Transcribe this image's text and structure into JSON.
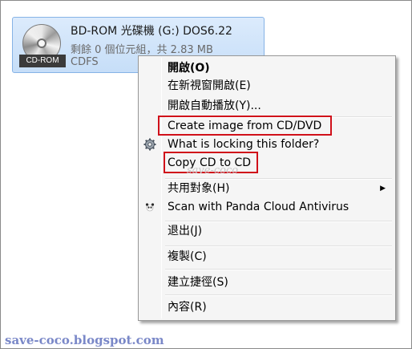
{
  "drive": {
    "title": "BD-ROM 光碟機 (G:) DOS6.22",
    "free_space": "剩餘 0 個位元組，共 2.83 MB",
    "filesystem": "CDFS",
    "icon_label": "CD-ROM",
    "icon": "cd-rom-drive-icon"
  },
  "menu": {
    "items": [
      {
        "label": "開啟(O)"
      },
      {
        "label": "在新視窗開啟(E)"
      },
      {
        "label": "開啟自動播放(Y)..."
      },
      {
        "label": "Create image from CD/DVD"
      },
      {
        "label": "What is locking this folder?",
        "icon": "gear-icon"
      },
      {
        "label": "Copy CD to CD"
      },
      {
        "label": "共用對象(H)",
        "submenu_arrow": "▶"
      },
      {
        "label": "Scan with Panda Cloud Antivirus",
        "icon": "panda-icon"
      },
      {
        "label": "退出(J)"
      },
      {
        "label": "複製(C)"
      },
      {
        "label": "建立捷徑(S)"
      },
      {
        "label": "內容(R)"
      }
    ]
  },
  "watermark": {
    "mid": "save-coco",
    "bottom": "save-coco.blogspot.com"
  },
  "colors": {
    "highlight_box": "#d0101a",
    "selection_bg": "#c6def8"
  }
}
